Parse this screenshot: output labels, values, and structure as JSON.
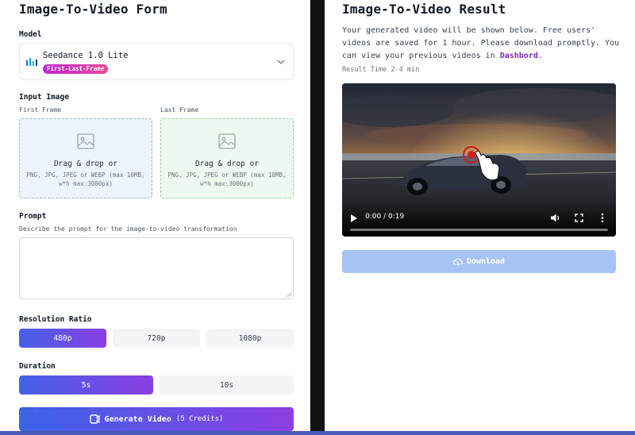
{
  "form": {
    "title": "Image-To-Video Form",
    "model_label": "Model",
    "model": {
      "name": "Seedance 1.0 Lite",
      "badge": "First-Last-Frame"
    },
    "input_image_label": "Input Image",
    "first_frame": {
      "label": "First Frame",
      "title": "Drag & drop or",
      "hint": "PNG, JPG, JPEG or WEBP (max 10MB, w*h max:3000px)"
    },
    "last_frame": {
      "label": "Last Frame",
      "title": "Drag & drop or",
      "hint": "PNG, JPG, JPEG or WEBP (max 10MB, w*h max:3000px)"
    },
    "prompt": {
      "label": "Prompt",
      "description": "Describe the prompt for the image-to-video transformation",
      "value": ""
    },
    "resolution": {
      "label": "Resolution Ratio",
      "options": [
        "480p",
        "720p",
        "1080p"
      ],
      "selected": "480p"
    },
    "duration": {
      "label": "Duration",
      "options": [
        "5s",
        "10s"
      ],
      "selected": "5s"
    },
    "generate": {
      "label": "Generate Video",
      "credits": "(5 Credits)"
    }
  },
  "result": {
    "title": "Image-To-Video Result",
    "description_before": "Your generated video will be shown below. Free users' videos are saved for 1 hour. Please download promptly. You can view your previous videos in",
    "link_text": "Dashbord",
    "description_after": ".",
    "time_note": "Result Time 2-4 min",
    "video": {
      "time": "0:00 / 0:19",
      "progress": 0.0
    },
    "download_label": "Download"
  },
  "colors": {
    "accent_start": "#3b63e8",
    "accent_end": "#8d3fe3",
    "badge": "#d946ef",
    "link": "#7e22ce",
    "download_disabled": "#a7c3f4"
  }
}
